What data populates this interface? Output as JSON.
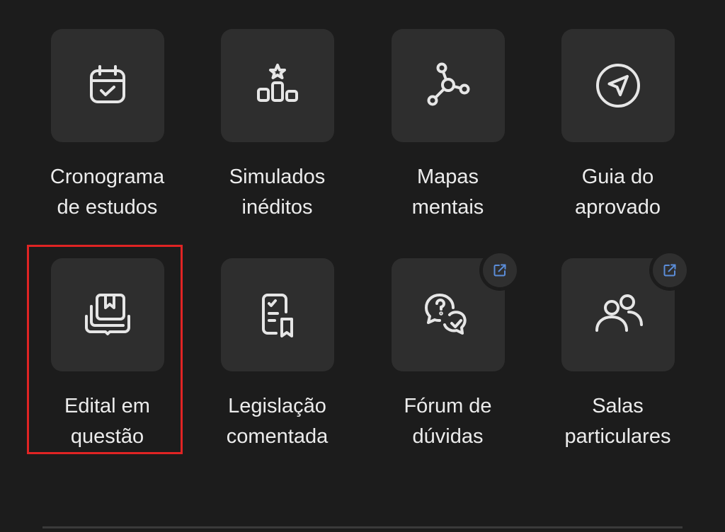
{
  "colors": {
    "background": "#1c1c1c",
    "tile": "#2e2e2e",
    "text": "#ececec",
    "icon_stroke": "#e6e6e6",
    "external_link": "#5b8dd9",
    "highlight": "#e02424"
  },
  "tiles": [
    {
      "label": "Cronograma\nde estudos",
      "icon": "calendar-check-icon"
    },
    {
      "label": "Simulados\ninéditos",
      "icon": "podium-star-icon"
    },
    {
      "label": "Mapas\nmentais",
      "icon": "mind-map-icon"
    },
    {
      "label": "Guia do\naprovado",
      "icon": "navigation-compass-icon"
    },
    {
      "label": "Edital em\nquestão",
      "icon": "book-stack-icon",
      "highlighted": true
    },
    {
      "label": "Legislação\ncomentada",
      "icon": "document-bookmark-icon"
    },
    {
      "label": "Fórum de\ndúvidas",
      "icon": "question-chat-icon",
      "external": true,
      "badge_icon": "external-link-icon"
    },
    {
      "label": "Salas\nparticulares",
      "icon": "users-icon",
      "external": true,
      "badge_icon": "external-link-icon"
    }
  ]
}
